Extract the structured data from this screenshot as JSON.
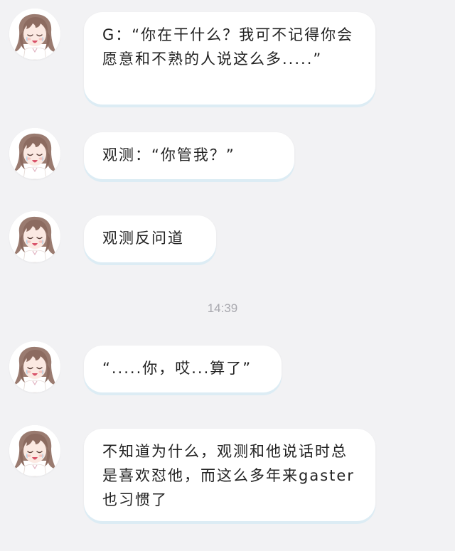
{
  "colors": {
    "background": "#f2f2f4",
    "bubble": "#ffffff",
    "bubble_shadow": "#dcecf4",
    "text": "#222222",
    "timestamp": "#a8a8ae"
  },
  "messages": [
    {
      "avatar_icon": "anime-girl-avatar-icon",
      "text": "G：“你在干什么？我可不记得你会愿意和不熟的人说这么多.....”"
    },
    {
      "avatar_icon": "anime-girl-avatar-icon",
      "text": "观测：“你管我？”"
    },
    {
      "avatar_icon": "anime-girl-avatar-icon",
      "text": "观测反问道"
    },
    {
      "avatar_icon": "anime-girl-avatar-icon",
      "text": "“.....你，哎...算了”"
    },
    {
      "avatar_icon": "anime-girl-avatar-icon",
      "text": "不知道为什么，观测和他说话时总是喜欢怼他，而这么多年来gaster也习惯了"
    }
  ],
  "timestamp": "14:39"
}
